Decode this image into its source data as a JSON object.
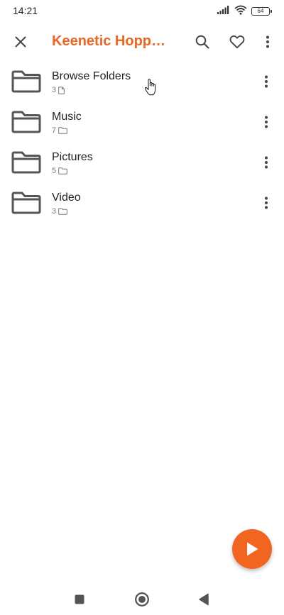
{
  "status_bar": {
    "time": "14:21",
    "battery_level": "64",
    "icons": [
      "signal-icon",
      "wifi-icon",
      "battery-icon"
    ]
  },
  "toolbar": {
    "title": "Keenetic Hoppe…",
    "title_color": "#f26521",
    "icons": [
      "close-icon",
      "search-icon",
      "heart-icon",
      "more-vertical-icon"
    ]
  },
  "list": {
    "items": [
      {
        "title": "Browse Folders",
        "count": "3",
        "meta_icon": "file-icon"
      },
      {
        "title": "Music",
        "count": "7",
        "meta_icon": "folder-small-icon"
      },
      {
        "title": "Pictures",
        "count": "5",
        "meta_icon": "folder-small-icon"
      },
      {
        "title": "Video",
        "count": "3",
        "meta_icon": "folder-small-icon"
      }
    ]
  },
  "fab": {
    "icon": "play-icon",
    "color": "#f26521"
  },
  "nav_bar": {
    "icons": [
      "recents-square-icon",
      "home-circle-icon",
      "back-triangle-icon"
    ]
  }
}
